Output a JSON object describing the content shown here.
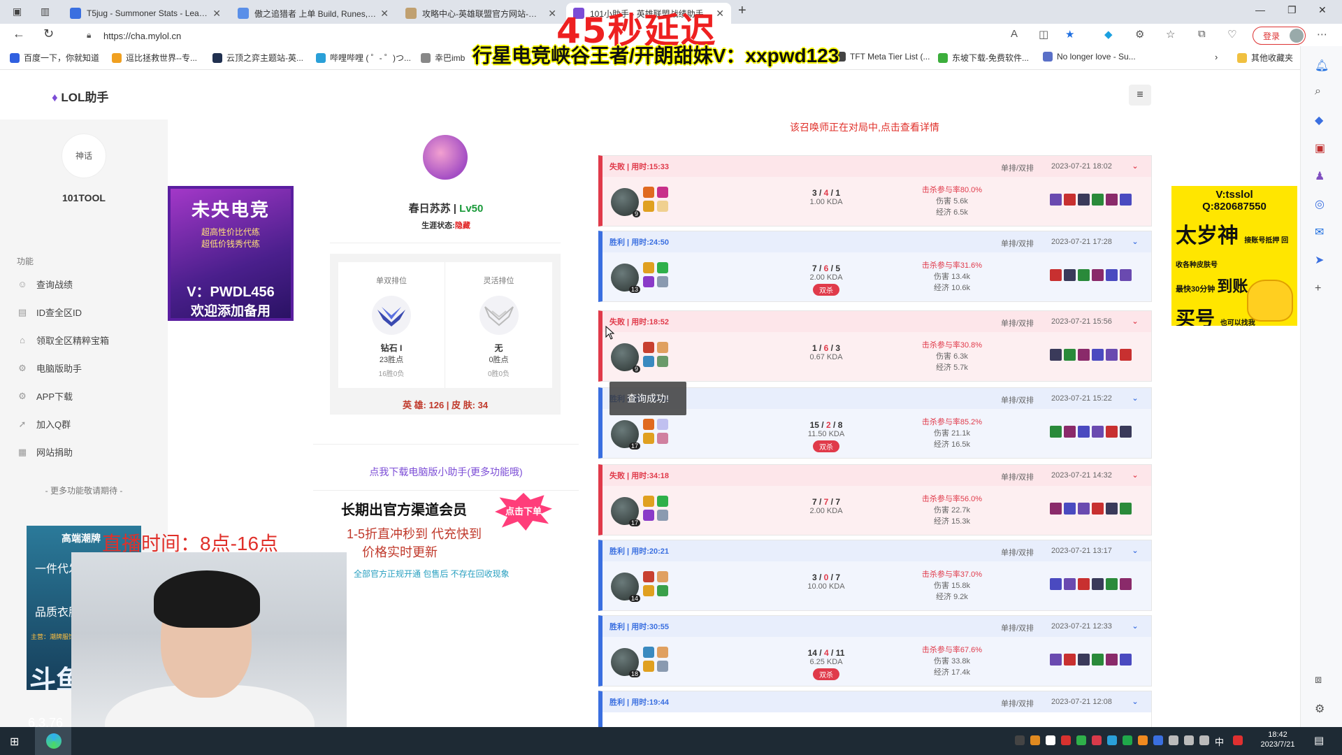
{
  "browser": {
    "tabs": [
      {
        "title": "T5jug - Summoner Stats - League",
        "color": "#3a6fe0"
      },
      {
        "title": "傲之追猎者 上单 Build, Runes, Co",
        "color": "#5a8fe8"
      },
      {
        "title": "攻略中心-英雄联盟官方网站-腾讯",
        "color": "#c0a070"
      },
      {
        "title": "101小助手 - 英雄联盟战绩助手",
        "color": "#7c4dd6"
      }
    ],
    "new_tab": "+",
    "url": "https://cha.mylol.cn",
    "login_label": "登录",
    "bookmarks": [
      "百度一下，你就知道",
      "逗比拯救世界--专...",
      "云顶之弈主题站-英...",
      "哔哩哔哩 ( ゜- ゜)つ...",
      "幸巴imb",
      "TFT Meta Tier List (...",
      "东坡下载-免费软件...",
      "No longer love - Su..."
    ],
    "bookmark_folder": "其他收藏夹"
  },
  "overlay": {
    "title": "45秒延迟",
    "subtitle": "行星电竞峡谷王者/开朗甜妹V：xxpwd123",
    "stream_time": "直播时间：8点-16点",
    "watermark": "6.3.76"
  },
  "site": {
    "logo": "LOL助手",
    "name": "101TOOL",
    "avatar_text": "神话",
    "section": "功能",
    "menu": [
      "查询战绩",
      "ID查全区ID",
      "领取全区精粹宝箱",
      "电脑版助手",
      "APP下载",
      "加入Q群",
      "网站捐助"
    ],
    "menu_icons": [
      "user-icon",
      "id-card-icon",
      "chest-icon",
      "gear-icon",
      "app-icon",
      "rocket-icon",
      "grid-icon"
    ],
    "more": "- 更多功能敬请期待 -"
  },
  "ad_left": {
    "line1": "未央电竞",
    "line2": "超高性价比代练",
    "line3": "超低价钱秀代练",
    "line4": "V：PWDL456",
    "line5": "欢迎添加备用"
  },
  "profile": {
    "name": "春日苏苏",
    "level": "Lv50",
    "state_label": "生涯状态:",
    "state_value": "隐藏",
    "ranks": [
      {
        "header": "单双排位",
        "tier": "钻石 I",
        "points": "23胜点",
        "record": "16胜0负"
      },
      {
        "header": "灵活排位",
        "tier": "无",
        "points": "0胜点",
        "record": "0胜0负"
      }
    ],
    "heroes_skins": "英 雄: 126 | 皮 肤: 34",
    "download": "点我下载电脑版小助手(更多功能哦)"
  },
  "ad_mid": {
    "line1": "长期出官方渠道会员",
    "burst": "点击下单",
    "line2": "1-5折直冲秒到 代充快到",
    "line3": "价格实时更新",
    "line4": "全部官方正规开通 包售后 不存在回收现象"
  },
  "notice": "该召唤师正在对局中,点击查看详情",
  "toast": "查询成功!",
  "matches": [
    {
      "result": "loss",
      "label": "失败 | 用时:15:33",
      "mode": "单排/双排",
      "date": "2023-07-21 18:02",
      "level": "9",
      "k": "3",
      "d": "4",
      "a": "1",
      "kda": "1.00 KDA",
      "badge": "",
      "kp": "击杀参与率80.0%",
      "dmg": "伤害 5.6k",
      "gold": "经济 6.5k"
    },
    {
      "result": "win",
      "label": "胜利 | 用时:24:50",
      "mode": "单排/双排",
      "date": "2023-07-21 17:28",
      "level": "13",
      "k": "7",
      "d": "6",
      "a": "5",
      "kda": "2.00 KDA",
      "badge": "双杀",
      "kp": "击杀参与率31.6%",
      "dmg": "伤害 13.4k",
      "gold": "经济 10.6k"
    },
    {
      "result": "loss",
      "label": "失败 | 用时:18:52",
      "mode": "单排/双排",
      "date": "2023-07-21 15:56",
      "level": "9",
      "k": "1",
      "d": "6",
      "a": "3",
      "kda": "0.67 KDA",
      "badge": "",
      "kp": "击杀参与率30.8%",
      "dmg": "伤害 6.3k",
      "gold": "经济 5.7k"
    },
    {
      "result": "win",
      "label": "胜利 | 用时:22:42",
      "mode": "单排/双排",
      "date": "2023-07-21 15:22",
      "level": "17",
      "k": "15",
      "d": "2",
      "a": "8",
      "kda": "11.50 KDA",
      "badge": "双杀",
      "kp": "击杀参与率85.2%",
      "dmg": "伤害 21.1k",
      "gold": "经济 16.5k"
    },
    {
      "result": "loss",
      "label": "失败 | 用时:34:18",
      "mode": "单排/双排",
      "date": "2023-07-21 14:32",
      "level": "17",
      "k": "7",
      "d": "7",
      "a": "7",
      "kda": "2.00 KDA",
      "badge": "",
      "kp": "击杀参与率56.0%",
      "dmg": "伤害 22.7k",
      "gold": "经济 15.3k"
    },
    {
      "result": "win",
      "label": "胜利 | 用时:20:21",
      "mode": "单排/双排",
      "date": "2023-07-21 13:17",
      "level": "14",
      "k": "3",
      "d": "0",
      "a": "7",
      "kda": "10.00 KDA",
      "badge": "",
      "kp": "击杀参与率37.0%",
      "dmg": "伤害 15.8k",
      "gold": "经济 9.2k"
    },
    {
      "result": "win",
      "label": "胜利 | 用时:30:55",
      "mode": "单排/双排",
      "date": "2023-07-21 12:33",
      "level": "18",
      "k": "14",
      "d": "4",
      "a": "11",
      "kda": "6.25 KDA",
      "badge": "双杀",
      "kp": "击杀参与率67.6%",
      "dmg": "伤害 33.8k",
      "gold": "经济 17.4k"
    },
    {
      "result": "win",
      "label": "胜利 | 用时:19:44",
      "mode": "单排/双排",
      "date": "2023-07-21 12:08",
      "level": "",
      "k": "",
      "d": "",
      "a": "",
      "kda": "",
      "badge": "",
      "kp": "",
      "dmg": "",
      "gold": ""
    }
  ],
  "ad_right": {
    "l1": "V:tsslol",
    "l2": "Q:820687550",
    "l3": "太岁神",
    "l3s": "接账号抵押 回收各种皮肤号",
    "l4": "最快30分钟",
    "l4b": "到账",
    "l5": "买号",
    "l5s": "也可以找我"
  },
  "left_ad": {
    "a": "高端潮牌",
    "b": "一件代发",
    "c": "品质衣服",
    "d": "主营：潮牌服饰",
    "e": "斗鱼"
  },
  "taskbar": {
    "time": "18:42",
    "date": "2023/7/21",
    "ime": "中"
  }
}
